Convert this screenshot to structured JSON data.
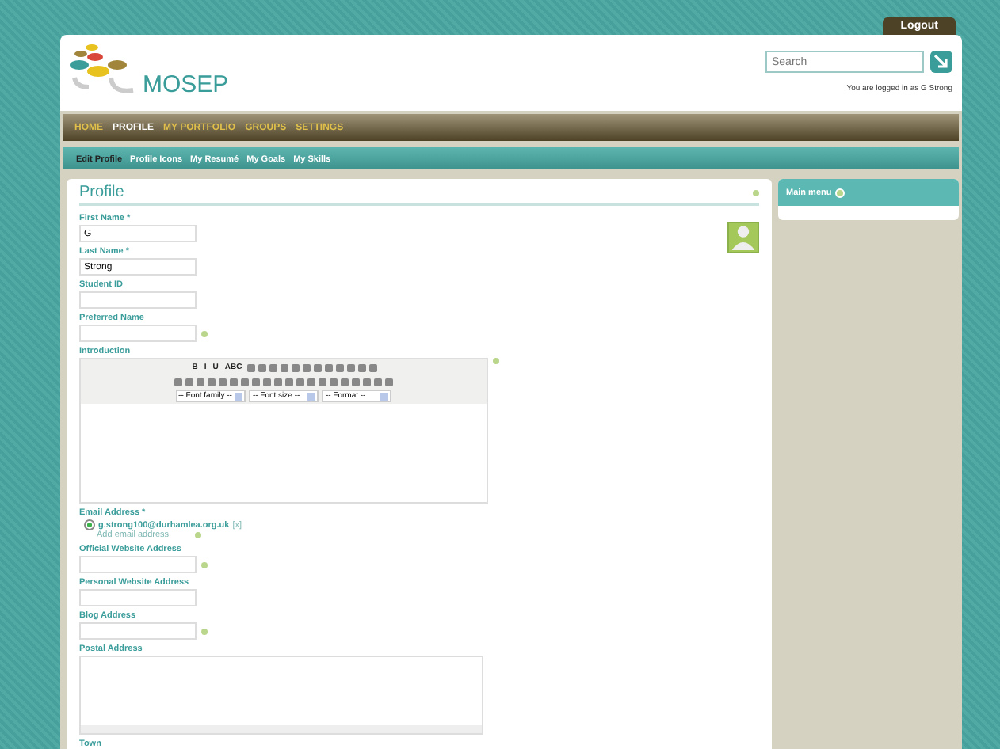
{
  "header": {
    "logout": "Logout",
    "logo": "MOSEP",
    "search": {
      "placeholder": "Search"
    },
    "logged_in": "You are logged in as G Strong"
  },
  "nav": [
    {
      "label": "HOME",
      "selected": false
    },
    {
      "label": "PROFILE",
      "selected": true
    },
    {
      "label": "MY PORTFOLIO",
      "selected": false
    },
    {
      "label": "GROUPS",
      "selected": false
    },
    {
      "label": "SETTINGS",
      "selected": false
    }
  ],
  "subnav": [
    {
      "label": "Edit Profile",
      "selected": true
    },
    {
      "label": "Profile Icons",
      "selected": false
    },
    {
      "label": "My Resumé",
      "selected": false
    },
    {
      "label": "My Goals",
      "selected": false
    },
    {
      "label": "My Skills",
      "selected": false
    }
  ],
  "profile": {
    "title": "Profile",
    "fields": [
      {
        "kind": "text",
        "label": "First Name *",
        "value": "G",
        "help": false
      },
      {
        "kind": "text",
        "label": "Last Name *",
        "value": "Strong",
        "help": false
      },
      {
        "kind": "text",
        "label": "Student ID",
        "help": false
      },
      {
        "kind": "text",
        "label": "Preferred Name",
        "help": true
      },
      {
        "kind": "editor",
        "label": "Introduction",
        "help": true,
        "toolbar_rows": [
          [
            "B",
            "I",
            "U",
            "ABC"
          ]
        ],
        "selects": [
          "-- Font family --",
          "-- Font size --",
          "-- Format --"
        ]
      },
      {
        "kind": "email",
        "label": "Email Address *",
        "help": true,
        "emails": [
          {
            "address": "g.strong100@durhamlea.org.uk",
            "remove": "[x]",
            "selected": true
          }
        ],
        "add": "Add email address"
      },
      {
        "kind": "text",
        "label": "Official Website Address",
        "help": true
      },
      {
        "kind": "text",
        "label": "Personal Website Address",
        "help": false
      },
      {
        "kind": "text",
        "label": "Blog Address",
        "help": true
      },
      {
        "kind": "textarea",
        "label": "Postal Address"
      },
      {
        "kind": "label",
        "label": "Town"
      }
    ]
  },
  "sidebar": {
    "title": "Main menu"
  }
}
